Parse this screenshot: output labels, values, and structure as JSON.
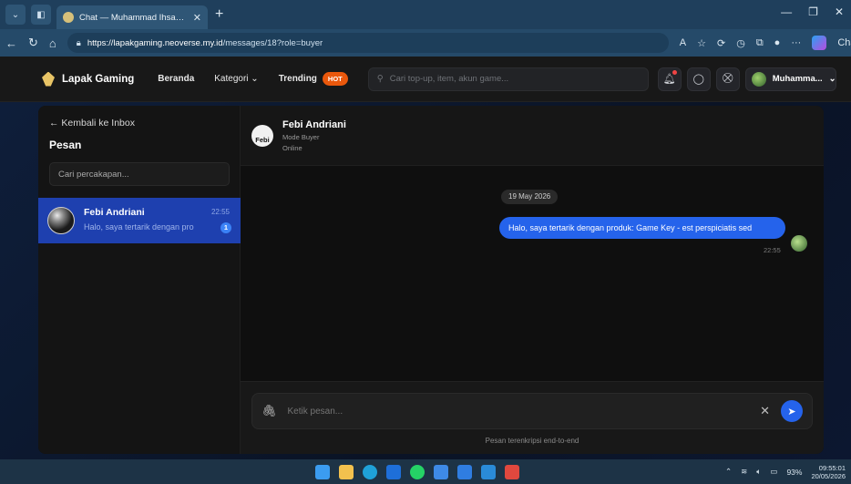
{
  "browser": {
    "tab_title": "Chat — Muhammad Ihsan Anwar",
    "tab_close": "✕",
    "new_tab": "+",
    "url_host": "https://lapakgaming.neoverse.my.id",
    "url_path": "/messages/18?role=buyer",
    "copilot_label": "Cha"
  },
  "site": {
    "brand": "Lapak Gaming",
    "nav": {
      "home": "Beranda",
      "category": "Kategori",
      "trending": "Trending",
      "hot_badge": "HOT"
    },
    "search_placeholder": "Cari top-up, item, akun game...",
    "user_name": "Muhamma..."
  },
  "sidebar": {
    "back_label": "← Kembali ke Inbox",
    "title": "Pesan",
    "search_placeholder": "Cari percakapan...",
    "conversations": [
      {
        "name": "Febi Andriani",
        "time": "22:55",
        "preview": "Halo, saya tertarik dengan pro",
        "unread": "1"
      }
    ]
  },
  "chat": {
    "avatar_text": "Febi",
    "name": "Febi Andriani",
    "mode": "Mode Buyer",
    "status": "Online",
    "date": "19 May 2026",
    "messages": [
      {
        "text": "Halo, saya tertarik dengan produk: Game Key - est perspiciatis sed",
        "time": "22:55"
      }
    ],
    "input_placeholder": "Ketik pesan...",
    "encryption_note": "Pesan terenkripsi end-to-end"
  },
  "taskbar": {
    "battery": "93%",
    "time": "09:55:01",
    "date": "20/05/2026"
  },
  "colors": {
    "accent": "#2563eb",
    "selected_conversation": "#1e40af",
    "hot_badge": "#ea580c"
  }
}
